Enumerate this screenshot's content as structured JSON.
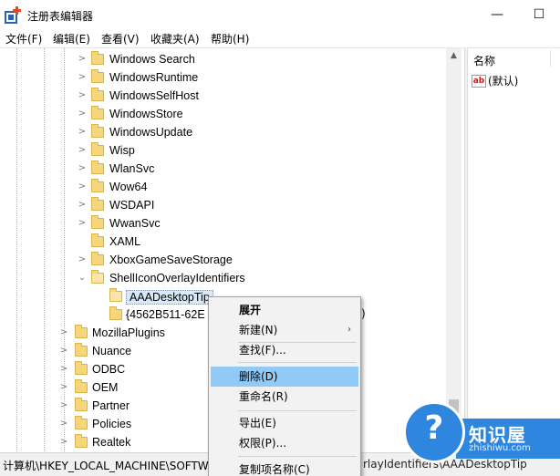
{
  "window": {
    "title": "注册表编辑器",
    "minimize": "—",
    "maximize": "☐"
  },
  "menu": [
    "文件(F)",
    "编辑(E)",
    "查看(V)",
    "收藏夹(A)",
    "帮助(H)"
  ],
  "tree": {
    "items": [
      {
        "label": "Windows Search",
        "expandable": true
      },
      {
        "label": "WindowsRuntime",
        "expandable": true
      },
      {
        "label": "WindowsSelfHost",
        "expandable": true
      },
      {
        "label": "WindowsStore",
        "expandable": true
      },
      {
        "label": "WindowsUpdate",
        "expandable": true
      },
      {
        "label": "Wisp",
        "expandable": true
      },
      {
        "label": "WlanSvc",
        "expandable": true
      },
      {
        "label": "Wow64",
        "expandable": true
      },
      {
        "label": "WSDAPI",
        "expandable": true
      },
      {
        "label": "WwanSvc",
        "expandable": true
      },
      {
        "label": "XAML",
        "expandable": false
      },
      {
        "label": "XboxGameSaveStorage",
        "expandable": true
      },
      {
        "label": "ShellIconOverlayIdentifiers",
        "expandable": true
      },
      {
        "label": "AAADesktopTip",
        "expandable": false
      },
      {
        "label": "{4562B511-62E",
        "expandable": false
      },
      {
        "label": "MozillaPlugins",
        "expandable": true
      },
      {
        "label": "Nuance",
        "expandable": true
      },
      {
        "label": "ODBC",
        "expandable": true
      },
      {
        "label": "OEM",
        "expandable": true
      },
      {
        "label": "Partner",
        "expandable": true
      },
      {
        "label": "Policies",
        "expandable": true
      },
      {
        "label": "Realtek",
        "expandable": true
      }
    ],
    "fragment_after_menu": ")"
  },
  "values_pane": {
    "header": "名称",
    "ab_icon": "ab",
    "default_value": "(默认)"
  },
  "context_menu": {
    "items": [
      {
        "label": "展开",
        "bold": true,
        "arrow": ""
      },
      {
        "label": "新建(N)",
        "bold": false,
        "arrow": "›"
      },
      {
        "label": "查找(F)...",
        "bold": false,
        "arrow": ""
      },
      {
        "label": "删除(D)",
        "bold": false,
        "arrow": "",
        "highlighted": true
      },
      {
        "label": "重命名(R)",
        "bold": false,
        "arrow": ""
      },
      {
        "label": "导出(E)",
        "bold": false,
        "arrow": ""
      },
      {
        "label": "权限(P)...",
        "bold": false,
        "arrow": ""
      },
      {
        "label": "复制项名称(C)",
        "bold": false,
        "arrow": ""
      }
    ]
  },
  "status": {
    "path_start": "计算机\\HKEY_LOCAL_MACHINE\\SOFTWA",
    "path_end": "rlayIdentifiers\\AAADesktopTip"
  },
  "watermark": {
    "glyph": "?",
    "text": "知识屋",
    "sub": "zhishiwu.com"
  },
  "colors": {
    "highlight": "#91c9f7",
    "folder": "#f6d67a",
    "watermark": "#2e86de"
  }
}
